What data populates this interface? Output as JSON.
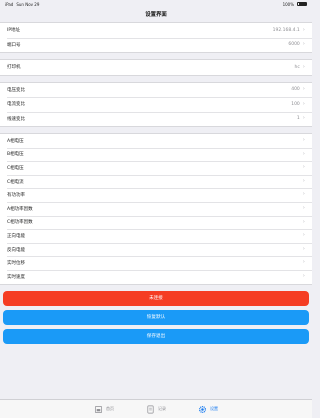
{
  "status_bar": {
    "device": "iPad",
    "time": "Sun Nov 29",
    "battery": "100%"
  },
  "nav": {
    "title": "设置界面"
  },
  "groups": [
    {
      "rows": [
        {
          "label": "IP地址",
          "value": "192.168.4.1"
        },
        {
          "label": "端口号",
          "value": "6000"
        }
      ]
    },
    {
      "rows": [
        {
          "label": "打印机",
          "value": "hc"
        }
      ]
    },
    {
      "rows": [
        {
          "label": "电压变比",
          "value": "400"
        },
        {
          "label": "电流变比",
          "value": "100"
        },
        {
          "label": "线速变比",
          "value": "1"
        }
      ]
    },
    {
      "rows": [
        {
          "label": "A相电压",
          "value": ""
        },
        {
          "label": "B相电压",
          "value": ""
        },
        {
          "label": "C相电压",
          "value": ""
        },
        {
          "label": "C相电流",
          "value": ""
        },
        {
          "label": "有功功率",
          "value": ""
        },
        {
          "label": "A相功率因数",
          "value": ""
        },
        {
          "label": "C相功率因数",
          "value": ""
        },
        {
          "label": "正向电能",
          "value": ""
        },
        {
          "label": "反向电能",
          "value": ""
        },
        {
          "label": "实时位移",
          "value": ""
        },
        {
          "label": "实时速度",
          "value": ""
        }
      ]
    }
  ],
  "buttons": {
    "red": "未连接",
    "blue1": "恢复默认",
    "blue2": "保存退出"
  },
  "tabs": [
    {
      "label": "首页",
      "icon": "home-icon"
    },
    {
      "label": "记录",
      "icon": "document-icon"
    },
    {
      "label": "设置",
      "icon": "gear-icon",
      "active": true
    }
  ],
  "colors": {
    "red": "#f53d23",
    "blue": "#1a9af7",
    "active_tab": "#1a7cf0"
  }
}
